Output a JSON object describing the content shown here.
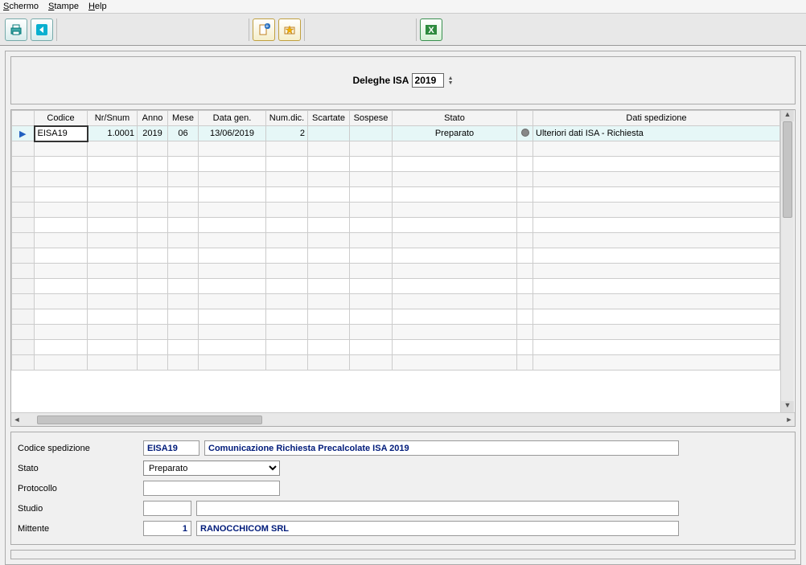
{
  "menu": {
    "schermo": "Schermo",
    "stampe": "Stampe",
    "help": "Help"
  },
  "header": {
    "title": "Deleghe ISA",
    "year": "2019"
  },
  "columns": {
    "codice": "Codice",
    "nrsnum": "Nr/Snum",
    "anno": "Anno",
    "mese": "Mese",
    "datagen": "Data gen.",
    "numdic": "Num.dic.",
    "scartate": "Scartate",
    "sospese": "Sospese",
    "stato": "Stato",
    "datisped": "Dati spedizione"
  },
  "rows": [
    {
      "codice": "EISA19",
      "nrsnum": "1.0001",
      "anno": "2019",
      "mese": "06",
      "datagen": "13/06/2019",
      "numdic": "2",
      "scartate": "",
      "sospese": "",
      "stato": "Preparato",
      "datisped": "Ulteriori dati ISA - Richiesta"
    }
  ],
  "details": {
    "label_codice": "Codice spedizione",
    "codice": "EISA19",
    "codice_desc": "Comunicazione Richiesta Precalcolate ISA 2019",
    "label_stato": "Stato",
    "stato": "Preparato",
    "label_protocollo": "Protocollo",
    "protocollo": "",
    "label_studio": "Studio",
    "studio_code": "",
    "studio_desc": "",
    "label_mittente": "Mittente",
    "mittente_code": "1",
    "mittente_desc": "RANOCCHICOM SRL"
  }
}
